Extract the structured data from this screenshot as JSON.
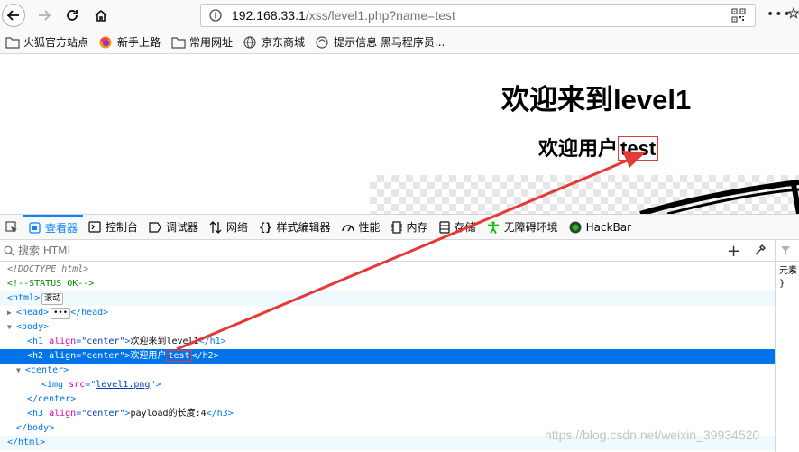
{
  "browser": {
    "url_protocol_host": "192.168.33.1",
    "url_path": "/xss/level1.php?name=test",
    "more_label": "•••"
  },
  "bookmarks": [
    {
      "label": "火狐官方站点",
      "icon": "folder-icon"
    },
    {
      "label": "新手上路",
      "icon": "firefox-icon"
    },
    {
      "label": "常用网址",
      "icon": "folder-icon"
    },
    {
      "label": "京东商城",
      "icon": "globe-icon"
    },
    {
      "label": "提示信息 黑马程序员...",
      "icon": "page-icon"
    }
  ],
  "page": {
    "h1": "欢迎来到level1",
    "h2_prefix": "欢迎用户",
    "h2_name": "test"
  },
  "devtools": {
    "tabs": [
      {
        "label": "查看器",
        "icon": "inspector-icon",
        "active": true
      },
      {
        "label": "控制台",
        "icon": "console-icon"
      },
      {
        "label": "调试器",
        "icon": "debugger-icon"
      },
      {
        "label": "网络",
        "icon": "network-icon"
      },
      {
        "label": "样式编辑器",
        "icon": "style-editor-icon"
      },
      {
        "label": "性能",
        "icon": "performance-icon"
      },
      {
        "label": "内存",
        "icon": "memory-icon"
      },
      {
        "label": "存储",
        "icon": "storage-icon"
      },
      {
        "label": "无障碍环境",
        "icon": "accessibility-icon"
      },
      {
        "label": "HackBar",
        "icon": "hackbar-icon"
      }
    ],
    "search_placeholder": "搜索 HTML",
    "side_text_1": "元素",
    "side_text_2": "}",
    "tree": {
      "doctype": "<!DOCTYPE html>",
      "comment": "<!--STATUS OK-->",
      "html_open": "<html>",
      "scroll_badge": "滚动",
      "head_open": "<head>",
      "head_ellipsis": "•••",
      "head_close": "</head>",
      "body_open": "<body>",
      "h1_tag": "<h1",
      "h1_attr": "align",
      "h1_val": "\"center\"",
      "h1_text": "欢迎来到level1",
      "h1_close": "</h1>",
      "h2_tag": "<h2",
      "h2_attr": "align",
      "h2_val": "\"center\"",
      "h2_text_prefix": "欢迎用户",
      "h2_text_name": "test",
      "h2_close": "</h2>",
      "center_open": "<center>",
      "img_tag": "<img",
      "img_attr": "src",
      "img_val": "level1.png",
      "center_close": "</center>",
      "h3_tag": "<h3",
      "h3_attr": "align",
      "h3_val": "\"center\"",
      "h3_text": "payload的长度:4",
      "h3_close": "</h3>",
      "body_close": "</body>",
      "html_close": "</html>"
    }
  },
  "watermark": "https://blog.csdn.net/weixin_39934520",
  "colors": {
    "accent": "#0a84ff",
    "selection": "#0074e8",
    "annotation": "#e53935"
  }
}
